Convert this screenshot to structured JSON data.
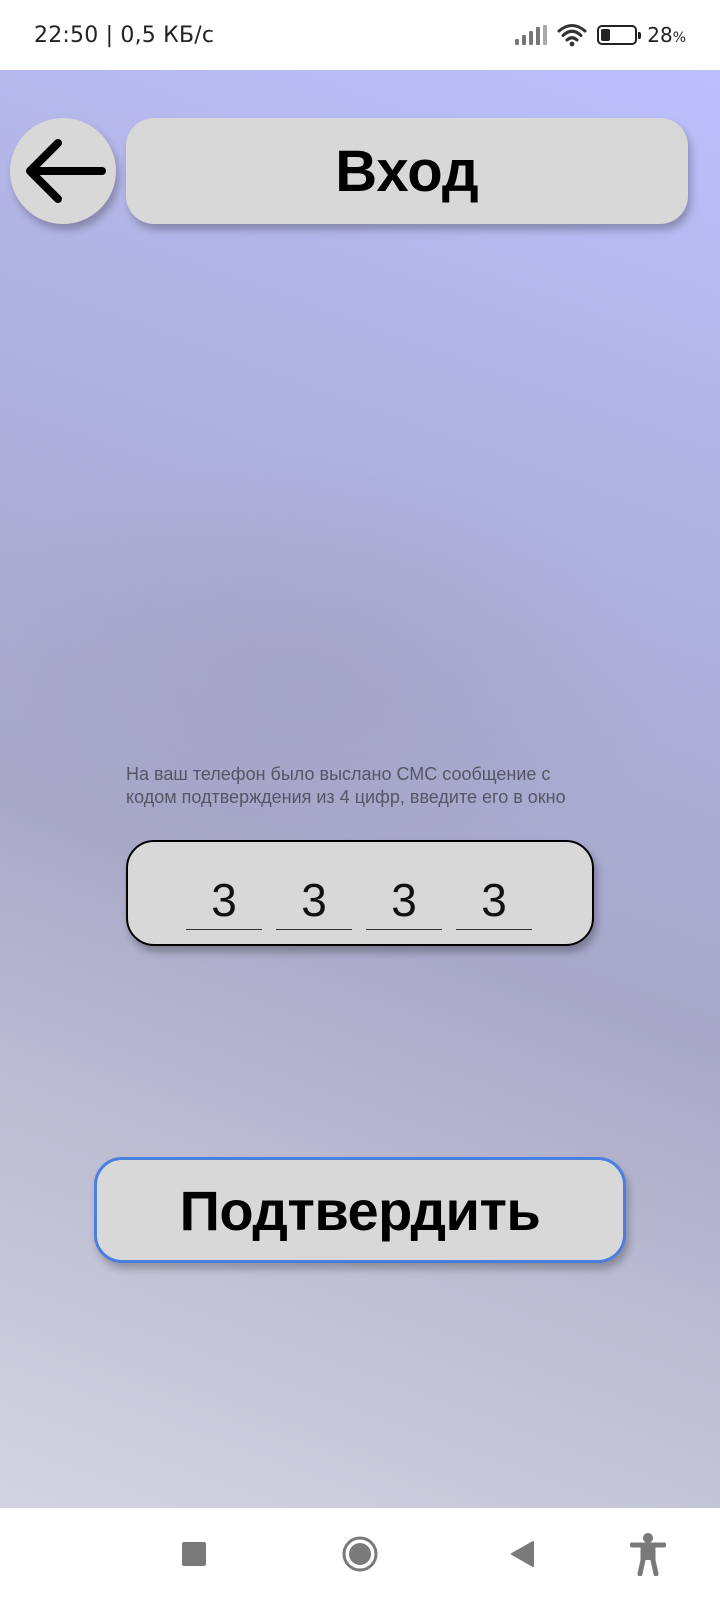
{
  "status_bar": {
    "time_speed": "22:50 | 0,5 КБ/с",
    "battery_percent": "28",
    "battery_suffix": "%",
    "battery_level": 0.28
  },
  "header": {
    "title": "Вход",
    "back_icon": "arrow-left-icon"
  },
  "verification": {
    "hint": "На ваш телефон было выслано СМС сообщение с кодом подтверждения из 4 цифр, введите его в окно",
    "digits": [
      "3",
      "3",
      "3",
      "3"
    ]
  },
  "confirm_button": {
    "label": "Подтвердить",
    "border_color": "#4a7fe0"
  },
  "nav_bar": {
    "icons": [
      "recents-square-icon",
      "home-circle-icon",
      "back-triangle-icon",
      "accessibility-icon"
    ]
  },
  "colors": {
    "card_bg": "#d8d8d8",
    "bg_top": "#bcbffd",
    "bg_bottom": "#d3d3e1"
  }
}
